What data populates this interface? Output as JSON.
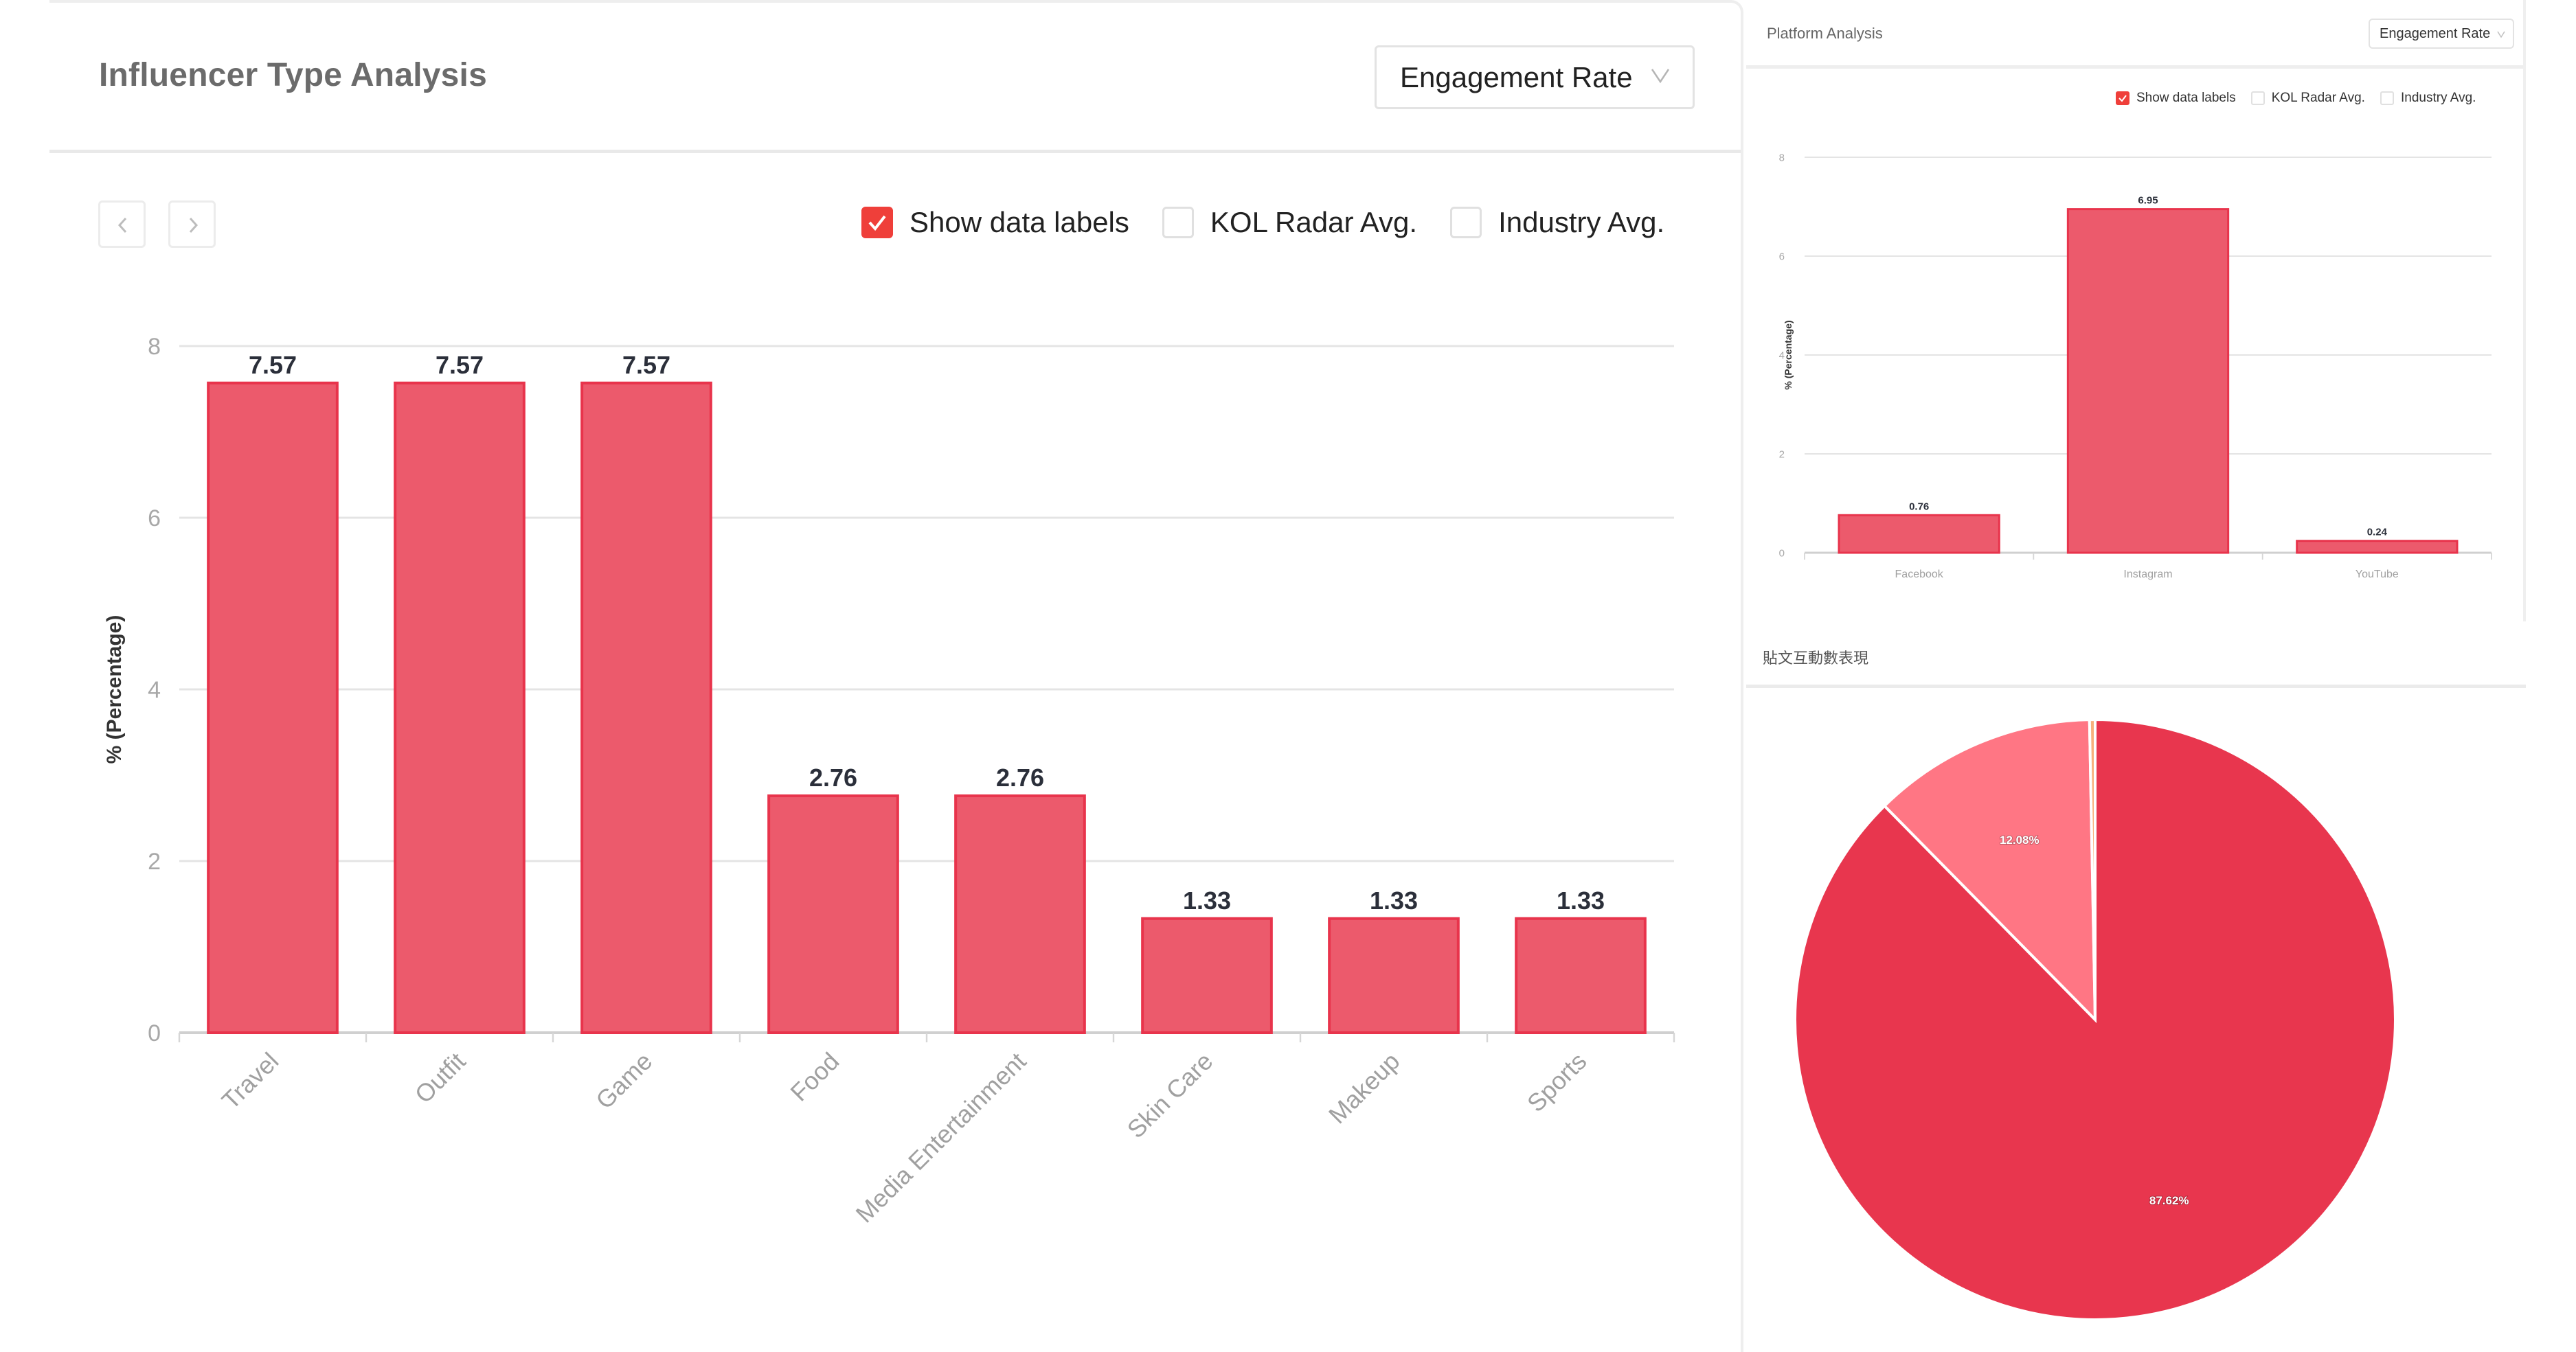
{
  "main": {
    "title": "Influencer Type Analysis",
    "dropdown_value": "Engagement Rate",
    "nav": {
      "prev_icon": "chevron-left-icon",
      "next_icon": "chevron-right-icon"
    },
    "checkboxes": [
      {
        "label": "Show data labels",
        "checked": true
      },
      {
        "label": "KOL Radar Avg.",
        "checked": false
      },
      {
        "label": "Industry Avg.",
        "checked": false
      }
    ]
  },
  "platform": {
    "title": "Platform Analysis",
    "dropdown_value": "Engagement Rate",
    "checkboxes": [
      {
        "label": "Show data labels",
        "checked": true
      },
      {
        "label": "KOL Radar Avg.",
        "checked": false
      },
      {
        "label": "Industry Avg.",
        "checked": false
      }
    ]
  },
  "pie": {
    "title": "貼文互動數表現"
  },
  "colors": {
    "bar_fill": "#ec5a6c",
    "bar_stroke": "#e8344c",
    "pie_primary": "#e8364e",
    "pie_secondary": "#ff7684",
    "pie_tertiary": "#f7b07c",
    "checkbox_accent": "#ef3f3a"
  },
  "chart_data": [
    {
      "type": "bar",
      "title": "Influencer Type Analysis",
      "xlabel": "",
      "ylabel": "% (Percentage)",
      "categories": [
        "Travel",
        "Outfit",
        "Game",
        "Food",
        "Media Entertainment",
        "Skin Care",
        "Makeup",
        "Sports"
      ],
      "values": [
        7.57,
        7.57,
        7.57,
        2.76,
        2.76,
        1.33,
        1.33,
        1.33
      ],
      "data_labels": [
        "7.57",
        "7.57",
        "7.57",
        "2.76",
        "2.76",
        "1.33",
        "1.33",
        "1.33"
      ],
      "yticks": [
        0,
        2,
        4,
        6,
        8
      ],
      "ylim": [
        0,
        8
      ],
      "grid": true,
      "legend": "none"
    },
    {
      "type": "bar",
      "title": "Platform Analysis",
      "xlabel": "",
      "ylabel": "% (Percentage)",
      "categories": [
        "Facebook",
        "Instagram",
        "YouTube"
      ],
      "values": [
        0.76,
        6.95,
        0.24
      ],
      "data_labels": [
        "0.76",
        "6.95",
        "0.24"
      ],
      "yticks": [
        0,
        2,
        4,
        6,
        8
      ],
      "ylim": [
        0,
        8
      ],
      "grid": true,
      "legend": "none"
    },
    {
      "type": "pie",
      "title": "貼文互動數表現",
      "slices": [
        {
          "value": 87.62,
          "label": "87.62%"
        },
        {
          "value": 12.08,
          "label": "12.08%"
        },
        {
          "value": 0.3,
          "label": ""
        }
      ],
      "legend": "none"
    }
  ]
}
